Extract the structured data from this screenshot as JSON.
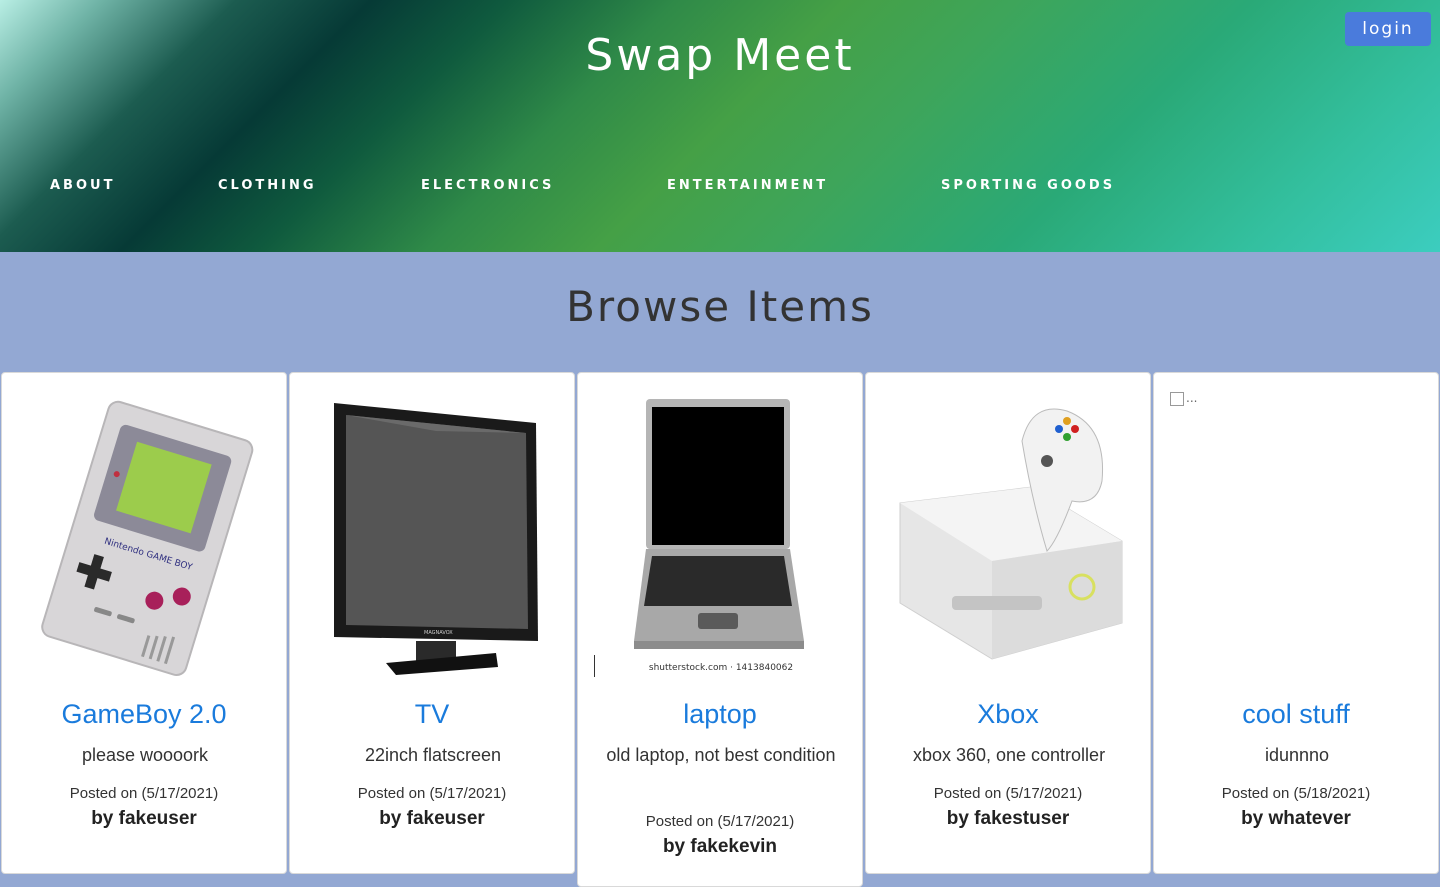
{
  "header": {
    "title": "Swap Meet",
    "login_label": "login",
    "nav": [
      "ABOUT",
      "CLOTHING",
      "ELECTRONICS",
      "ENTERTAINMENT",
      "SPORTING GOODS"
    ]
  },
  "main": {
    "heading": "Browse Items",
    "items": [
      {
        "name": "GameBoy 2.0",
        "description": "please woooork",
        "posted": "Posted on (5/17/2021)",
        "author": "by fakeuser",
        "image": "gameboy"
      },
      {
        "name": "TV",
        "description": "22inch flatscreen",
        "posted": "Posted on (5/17/2021)",
        "author": "by fakeuser",
        "image": "tv"
      },
      {
        "name": "laptop",
        "description": "old laptop, not best condition",
        "posted": "Posted on (5/17/2021)",
        "author": "by fakekevin",
        "image": "laptop",
        "image_caption": "shutterstock.com · 1413840062"
      },
      {
        "name": "Xbox",
        "description": "xbox 360, one controller",
        "posted": "Posted on (5/17/2021)",
        "author": "by fakestuser",
        "image": "xbox"
      },
      {
        "name": "cool stuff",
        "description": "idunnno",
        "posted": "Posted on (5/18/2021)",
        "author": "by whatever",
        "image": "broken",
        "image_alt": "..."
      }
    ]
  },
  "colors": {
    "accent_link": "#1a7bdc",
    "login_button": "#4a7bdc",
    "page_background": "#93a8d3"
  }
}
